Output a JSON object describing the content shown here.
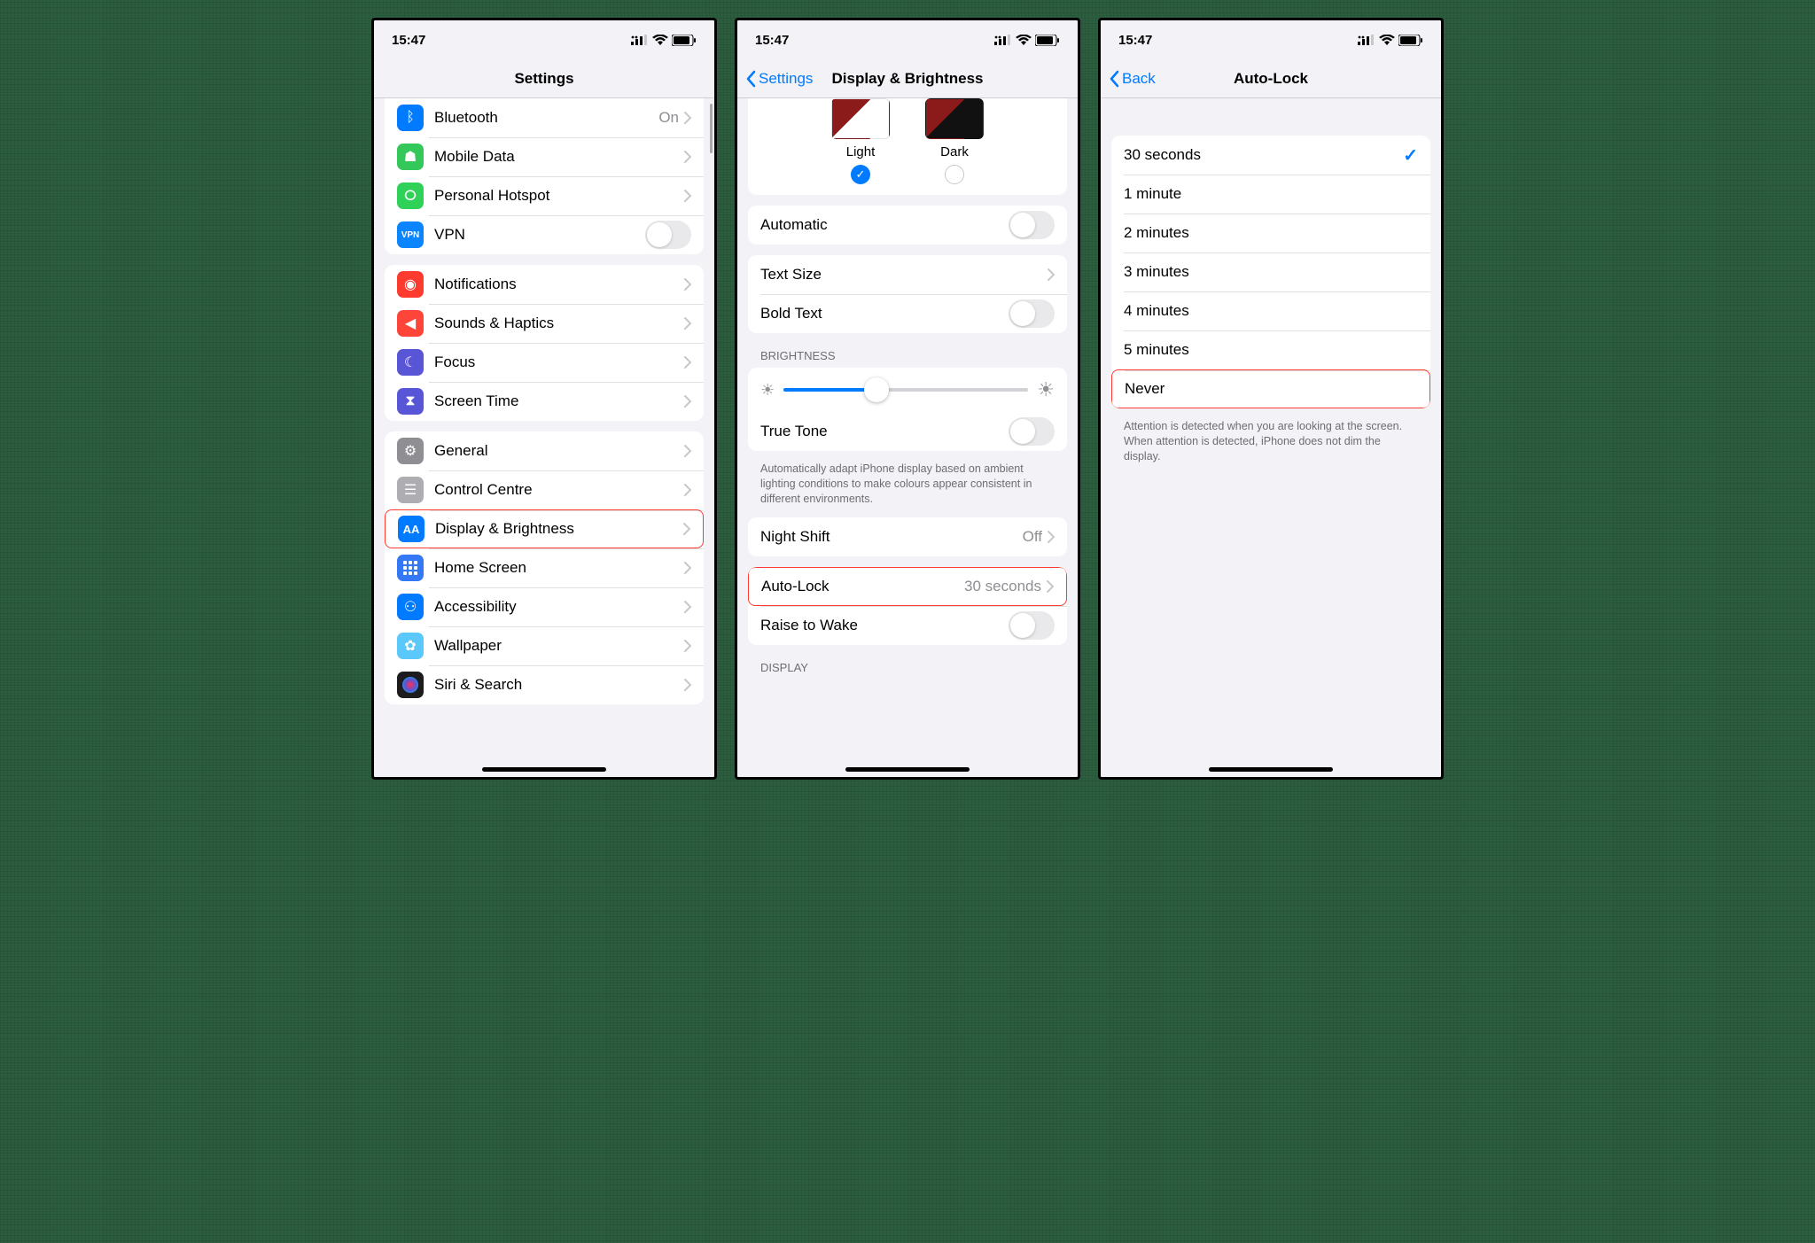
{
  "status": {
    "time": "15:47"
  },
  "screens": {
    "settings": {
      "title": "Settings",
      "groups": [
        [
          {
            "label": "Bluetooth",
            "value": "On",
            "chev": true,
            "icon": "bluetooth",
            "color": "ic-blue"
          },
          {
            "label": "Mobile Data",
            "chev": true,
            "icon": "antenna",
            "color": "ic-green"
          },
          {
            "label": "Personal Hotspot",
            "chev": true,
            "icon": "link",
            "color": "ic-green2"
          },
          {
            "label": "VPN",
            "toggle": true,
            "icon": "vpn",
            "color": "ic-bluev",
            "vpn": true
          }
        ],
        [
          {
            "label": "Notifications",
            "chev": true,
            "icon": "bell",
            "color": "ic-red"
          },
          {
            "label": "Sounds & Haptics",
            "chev": true,
            "icon": "speaker",
            "color": "ic-red2"
          },
          {
            "label": "Focus",
            "chev": true,
            "icon": "moon",
            "color": "ic-purple"
          },
          {
            "label": "Screen Time",
            "chev": true,
            "icon": "hourglass",
            "color": "ic-purple"
          }
        ],
        [
          {
            "label": "General",
            "chev": true,
            "icon": "gear",
            "color": "ic-gray"
          },
          {
            "label": "Control Centre",
            "chev": true,
            "icon": "sliders",
            "color": "ic-graylt"
          },
          {
            "label": "Display & Brightness",
            "chev": true,
            "icon": "AA",
            "color": "ic-blue",
            "highlight": true,
            "aa": true
          },
          {
            "label": "Home Screen",
            "chev": true,
            "icon": "grid",
            "color": "ic-blue",
            "grid": true
          },
          {
            "label": "Accessibility",
            "chev": true,
            "icon": "person",
            "color": "ic-blue"
          },
          {
            "label": "Wallpaper",
            "chev": true,
            "icon": "flower",
            "color": "ic-teal"
          },
          {
            "label": "Siri & Search",
            "chev": true,
            "icon": "siri",
            "color": "ic-black",
            "siri": true
          }
        ]
      ]
    },
    "display": {
      "back": "Settings",
      "title": "Display & Brightness",
      "appearance": {
        "light": "Light",
        "dark": "Dark",
        "selected": "light"
      },
      "automatic_label": "Automatic",
      "text_size": "Text Size",
      "bold_text": "Bold Text",
      "brightness_header": "BRIGHTNESS",
      "true_tone": "True Tone",
      "true_tone_footer": "Automatically adapt iPhone display based on ambient lighting conditions to make colours appear consistent in different environments.",
      "night_shift": "Night Shift",
      "night_shift_value": "Off",
      "auto_lock": "Auto-Lock",
      "auto_lock_value": "30 seconds",
      "raise_to_wake": "Raise to Wake",
      "display_header": "DISPLAY"
    },
    "autolock": {
      "back": "Back",
      "title": "Auto-Lock",
      "options": [
        {
          "label": "30 seconds",
          "checked": true
        },
        {
          "label": "1 minute"
        },
        {
          "label": "2 minutes"
        },
        {
          "label": "3 minutes"
        },
        {
          "label": "4 minutes"
        },
        {
          "label": "5 minutes"
        },
        {
          "label": "Never",
          "highlight": true
        }
      ],
      "footer": "Attention is detected when you are looking at the screen. When attention is detected, iPhone does not dim the display."
    }
  }
}
